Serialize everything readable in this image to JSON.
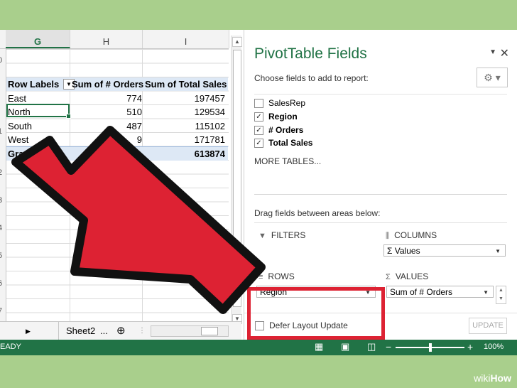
{
  "spreadsheet": {
    "columns": [
      "G",
      "H",
      "I"
    ],
    "row_numbers": [
      "0",
      "1",
      "2",
      "3",
      "4",
      "5",
      "6",
      "7",
      "8",
      "9",
      "0",
      "1",
      "2",
      "3",
      "4",
      "5",
      "6",
      "7",
      "8"
    ],
    "pivot_header": [
      "Row Labels",
      "Sum of # Orders",
      "Sum of Total Sales"
    ],
    "rows": [
      {
        "label": "East",
        "orders": "774",
        "sales": "197457"
      },
      {
        "label": "North",
        "orders": "510",
        "sales": "129534"
      },
      {
        "label": "South",
        "orders": "487",
        "sales": "115102"
      },
      {
        "label": "West",
        "orders": "9",
        "sales": "171781"
      }
    ],
    "total": {
      "label": "Grand Total",
      "orders": "",
      "sales": "613874"
    },
    "sheet_tab": "Sheet2",
    "sheet_ellipsis": "...",
    "add_sheet": "⊕"
  },
  "pivot_pane": {
    "title": "PivotTable Fields",
    "close": "✕",
    "caret": "▼",
    "choose_label": "Choose fields to add to report:",
    "gear": "⚙ ▾",
    "fields": [
      {
        "label": "SalesRep",
        "checked": false
      },
      {
        "label": "Region",
        "checked": true
      },
      {
        "label": "# Orders",
        "checked": true
      },
      {
        "label": "Total Sales",
        "checked": true
      }
    ],
    "more_tables": "MORE TABLES...",
    "drag_text": "Drag fields between areas below:",
    "areas": {
      "filters": {
        "label": "FILTERS",
        "icon": "▼"
      },
      "columns": {
        "label": "COLUMNS",
        "icon": "⫼",
        "value": "Values"
      },
      "rows": {
        "label": "ROWS",
        "icon": "≡",
        "value": "Region"
      },
      "values": {
        "label": "VALUES",
        "icon": "Σ",
        "value": "Sum of # Orders"
      }
    },
    "defer_label": "Defer Layout Update",
    "update_label": "UPDATE"
  },
  "status_bar": {
    "ready": "EADY",
    "zoom_minus": "−",
    "zoom_plus": "+",
    "zoom_level": "100%",
    "view_normal": "▦",
    "view_layout": "▣",
    "view_break": "◫"
  },
  "watermark": {
    "prefix": "wiki",
    "suffix": "How"
  },
  "colors": {
    "excel_green": "#217346",
    "highlight": "#dd2233",
    "background": "#a9cf8c"
  }
}
